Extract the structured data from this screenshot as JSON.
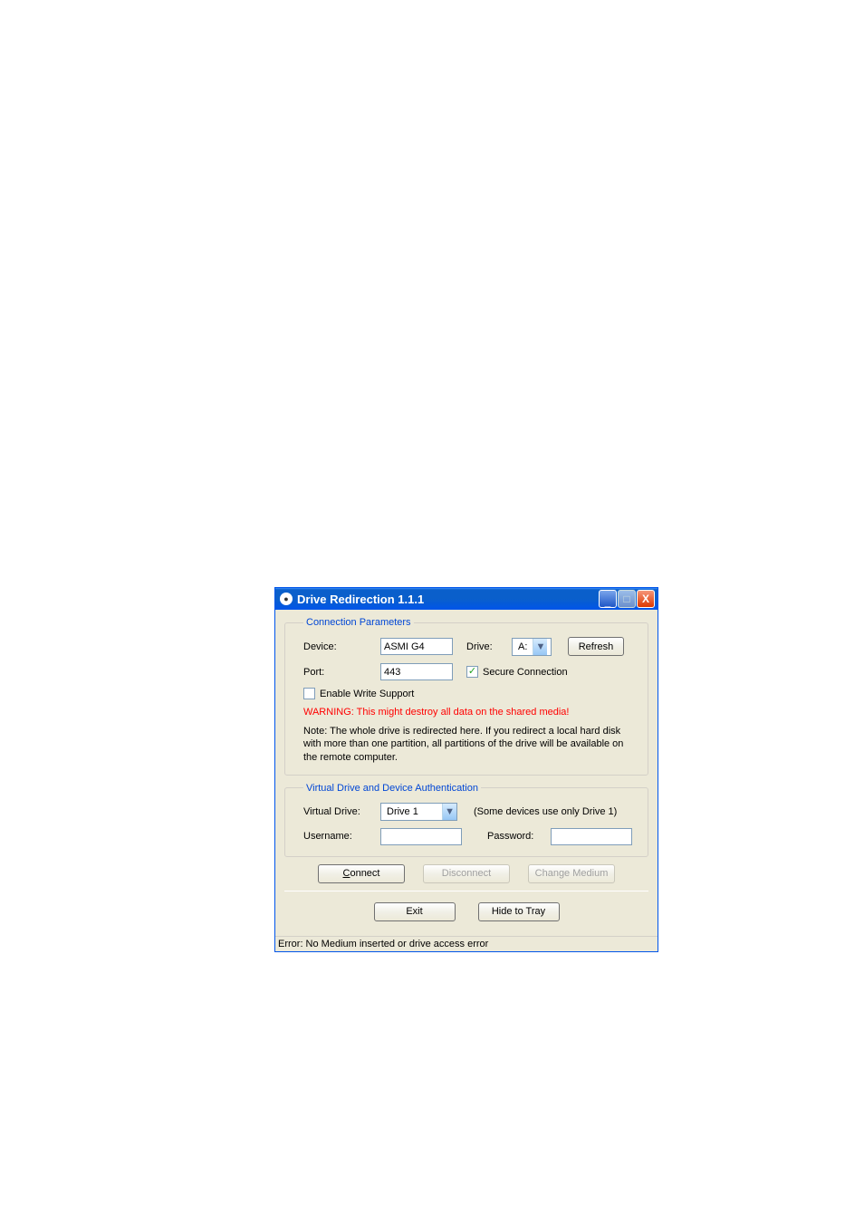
{
  "titlebar": {
    "title": "Drive Redirection 1.1.1",
    "minimize": "_",
    "maximize": "□",
    "close": "X"
  },
  "groups": {
    "connection": {
      "legend": "Connection Parameters",
      "device_label": "Device:",
      "device_value": "ASMI G4",
      "drive_label": "Drive:",
      "drive_value": "A:",
      "refresh": "Refresh",
      "port_label": "Port:",
      "port_value": "443",
      "secure_label": "Secure Connection",
      "secure_checked": "✓",
      "write_label": "Enable Write Support",
      "write_checked": "",
      "warning": "WARNING: This might destroy all data on the shared media!",
      "note": "Note: The whole drive is redirected here. If you redirect a local hard disk with more than one partition, all partitions of the drive will be available on the remote computer."
    },
    "auth": {
      "legend": "Virtual Drive and Device Authentication",
      "vdrive_label": "Virtual Drive:",
      "vdrive_value": "Drive 1",
      "vdrive_note": "(Some devices use only Drive 1)",
      "user_label": "Username:",
      "user_value": "",
      "pass_label": "Password:",
      "pass_value": ""
    }
  },
  "buttons": {
    "connect": "onnect",
    "connect_key": "C",
    "disconnect": "isconnect",
    "disconnect_key": "D",
    "change": "Change Medium",
    "exit": "Exit",
    "hide": "Hide to Tray"
  },
  "status": "Error: No Medium inserted or drive access error"
}
